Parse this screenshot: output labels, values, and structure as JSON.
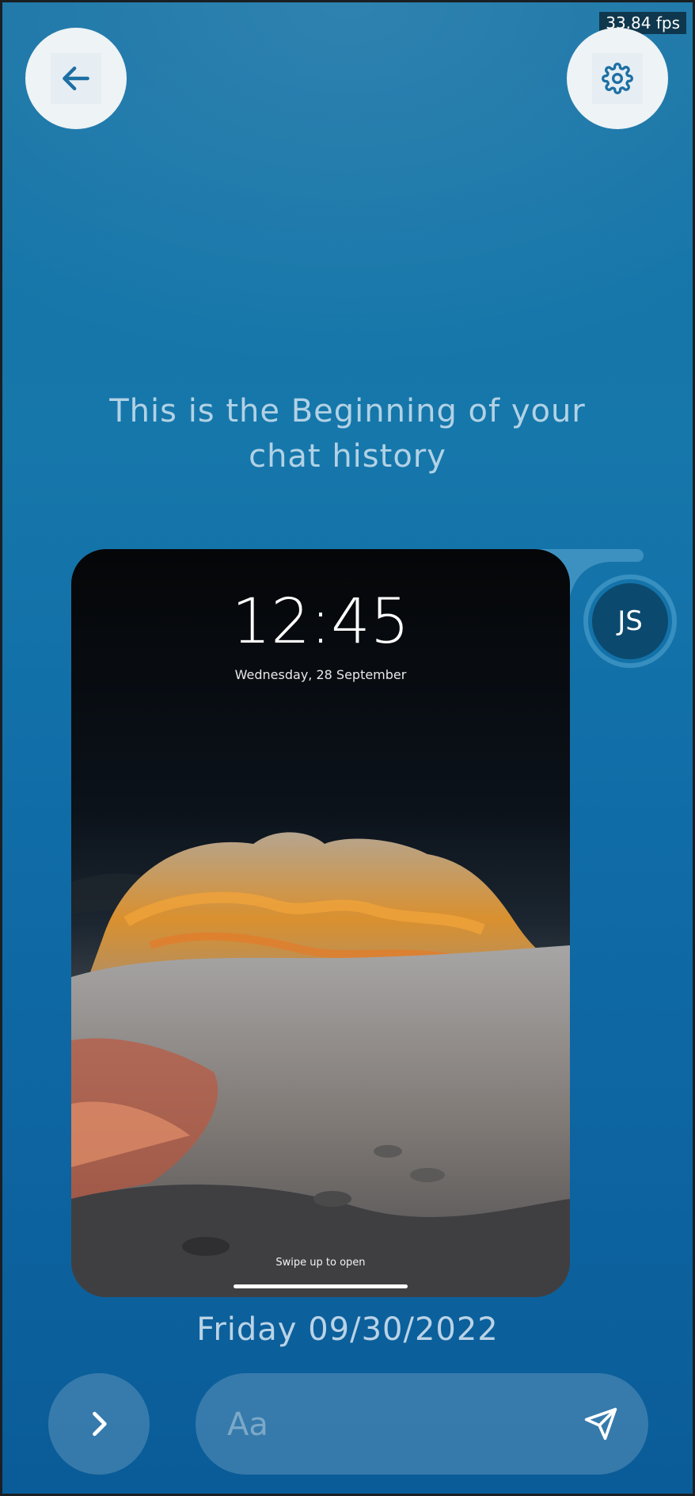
{
  "overlay": {
    "fps": "33.84 fps"
  },
  "header": {
    "back_icon": "arrow-left-icon",
    "settings_icon": "gear-icon"
  },
  "chat": {
    "history_line_1": "This is the Beginning of your",
    "history_line_2": "chat history",
    "avatar_initials": "JS",
    "date": "Friday 09/30/2022",
    "attachment": {
      "time": "12:45",
      "date": "Wednesday, 28 September",
      "hint": "Swipe up to open"
    }
  },
  "composer": {
    "placeholder": "Aa",
    "next_icon": "chevron-right-icon",
    "send_icon": "send-icon"
  },
  "colors": {
    "accent": "#0f6aa6",
    "avatar": "#0b4a6e",
    "button": "#eef3f6",
    "icon": "#1d6fa3"
  }
}
